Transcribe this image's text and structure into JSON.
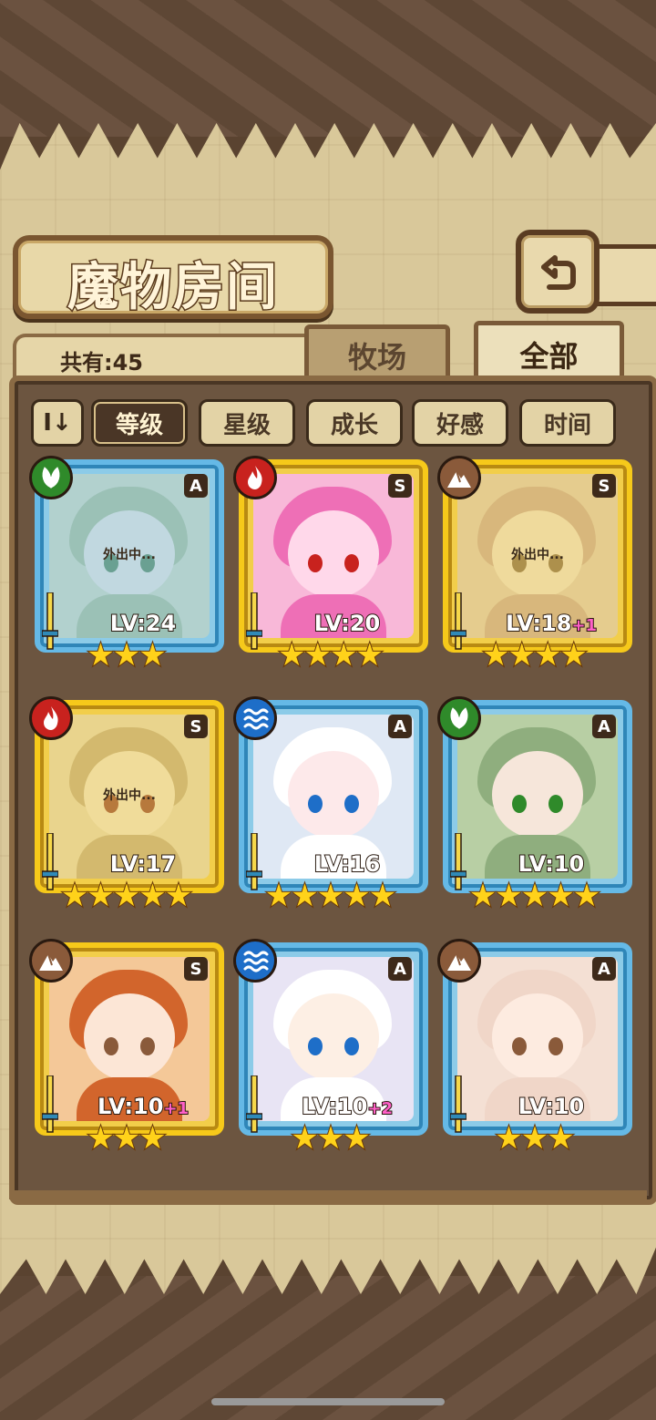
{
  "header": {
    "title": "魔物房间"
  },
  "count": {
    "label": "共有:45"
  },
  "tabs": {
    "ranch": "牧场",
    "all": "全部"
  },
  "sort": {
    "toggle": "I↓",
    "options": [
      "等级",
      "星级",
      "成长",
      "好感",
      "时间"
    ],
    "active": "等级"
  },
  "monsters": [
    {
      "element": "grass",
      "rank": "A",
      "level": "LV:24",
      "bonus": "",
      "stars": "★★★",
      "frame": "blue",
      "away": "外出中...",
      "palette": [
        "#cfd9a0",
        "#9fbf6a",
        "#f6e2d0"
      ]
    },
    {
      "element": "fire",
      "rank": "S",
      "level": "LV:20",
      "bonus": "",
      "stars": "★★★★",
      "frame": "gold",
      "away": "",
      "palette": [
        "#f8b8d8",
        "#ee6fb6",
        "#ffd8ea"
      ]
    },
    {
      "element": "earth",
      "rank": "S",
      "level": "LV:18",
      "bonus": "+1",
      "stars": "★★★★",
      "frame": "gold",
      "away": "外出中...",
      "palette": [
        "#e7c8c0",
        "#d9a0a0",
        "#f6e4d8"
      ]
    },
    {
      "element": "fire",
      "rank": "S",
      "level": "LV:17",
      "bonus": "",
      "stars": "★★★★★",
      "frame": "gold",
      "away": "外出中...",
      "palette": [
        "#e9dab0",
        "#c9a870",
        "#f6e8d0"
      ]
    },
    {
      "element": "water",
      "rank": "A",
      "level": "LV:16",
      "bonus": "",
      "stars": "★★★★★",
      "frame": "blue",
      "away": "",
      "palette": [
        "#dfe8f4",
        "#ffffff",
        "#fde9ea"
      ]
    },
    {
      "element": "grass",
      "rank": "A",
      "level": "LV:10",
      "bonus": "",
      "stars": "★★★★★",
      "frame": "blue",
      "away": "",
      "palette": [
        "#b8cfa4",
        "#8fae7e",
        "#f6e6da"
      ]
    },
    {
      "element": "earth",
      "rank": "S",
      "level": "LV:10",
      "bonus": "+1",
      "stars": "★★★",
      "frame": "gold",
      "away": "",
      "palette": [
        "#f4c898",
        "#d2652c",
        "#fce6d6"
      ]
    },
    {
      "element": "water",
      "rank": "A",
      "level": "LV:10",
      "bonus": "+2",
      "stars": "★★★",
      "frame": "blue",
      "away": "",
      "palette": [
        "#e8e4f4",
        "#ffffff",
        "#fdefe4"
      ]
    },
    {
      "element": "earth",
      "rank": "A",
      "level": "LV:10",
      "bonus": "",
      "stars": "★★★",
      "frame": "blue",
      "away": "",
      "palette": [
        "#f4e0d4",
        "#f0d6c8",
        "#fdebe0"
      ]
    }
  ],
  "colors": {
    "fire": "#c8221e",
    "grass": "#2f8a2a",
    "earth": "#8a5a3a",
    "water": "#1e6ec8"
  }
}
